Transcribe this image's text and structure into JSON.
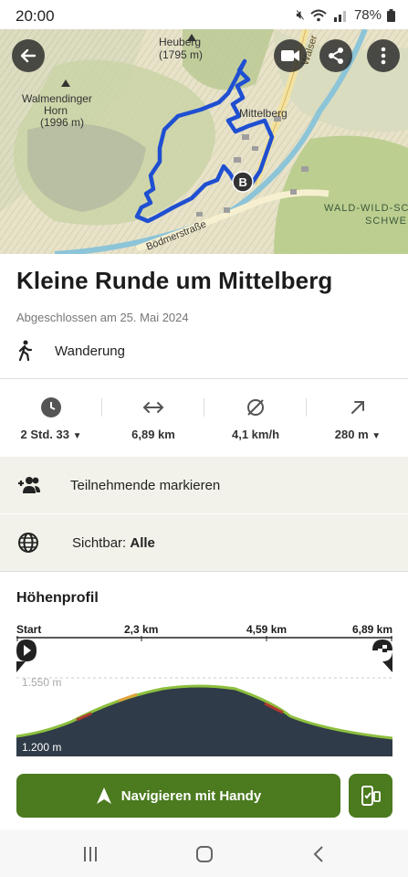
{
  "status_bar": {
    "time": "20:00",
    "battery": "78%"
  },
  "map": {
    "labels": {
      "heuberg": "Heuberg",
      "heuberg_elev": "(1795 m)",
      "walmendinger": "Walmendinger",
      "horn": "Horn",
      "horn_elev": "(1996 m)",
      "mittelberg": "Mittelberg",
      "walser": "Walser",
      "wald1": "WALD-WILD-SC",
      "wald2": "SCHWE",
      "road": "Bödmerstraße"
    },
    "marker": "B"
  },
  "tour": {
    "title": "Kleine Runde um Mittelberg",
    "completed": "Abgeschlossen am 25. Mai 2024",
    "activity": "Wanderung"
  },
  "stats": {
    "duration": "2 Std. 33",
    "distance": "6,89 km",
    "speed": "4,1 km/h",
    "elevation": "280 m"
  },
  "actions": {
    "mark_participants": "Teilnehmende markieren",
    "visibility_label": "Sichtbar:",
    "visibility_value": "Alle"
  },
  "elevation_profile": {
    "title": "Höhenprofil",
    "x_ticks": [
      "Start",
      "2,3 km",
      "4,59 km",
      "6,89 km"
    ],
    "y_ticks": [
      "1.550 m",
      "1.200 m"
    ]
  },
  "buttons": {
    "navigate": "Navigieren mit Handy"
  },
  "colors": {
    "accent": "#4b7a1f",
    "route": "#1f4fd1",
    "profile_fill": "#2f3b48"
  }
}
